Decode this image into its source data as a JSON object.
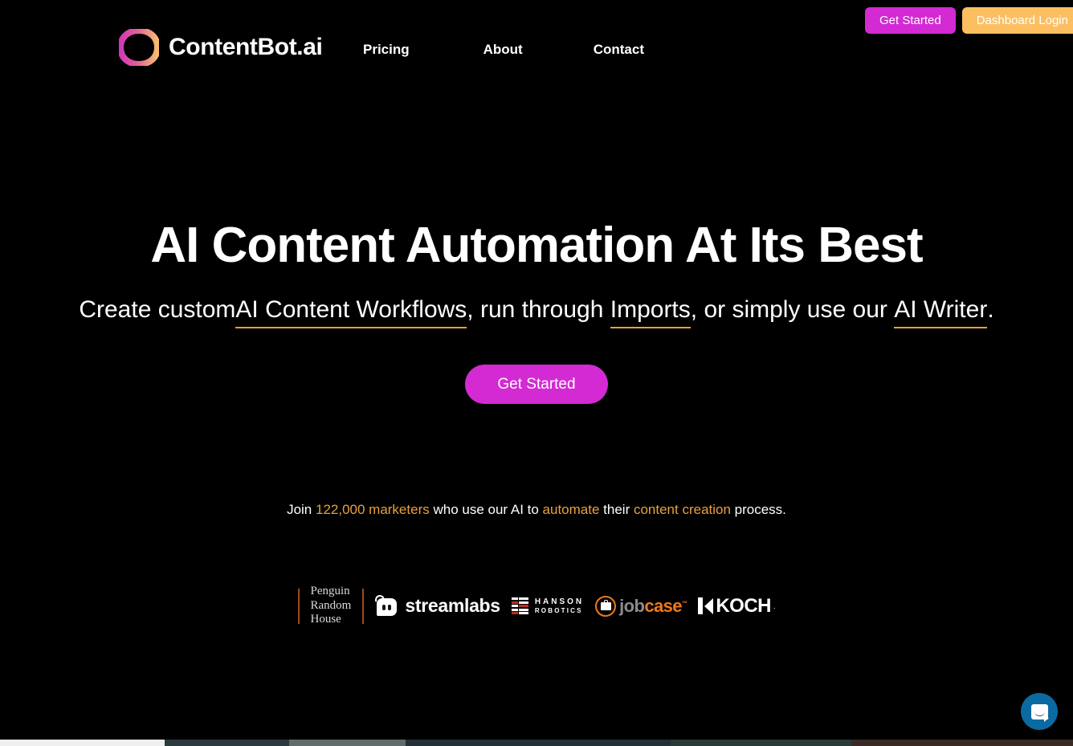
{
  "brand": {
    "name": "ContentBot.ai",
    "logo_icon": "gradient-ring-logo"
  },
  "nav": {
    "items": [
      {
        "label": "Pricing"
      },
      {
        "label": "About"
      },
      {
        "label": "Contact"
      }
    ]
  },
  "header_actions": {
    "get_started_label": "Get Started",
    "dashboard_login_label": "Dashboard Login"
  },
  "hero": {
    "title": "AI Content Automation At Its Best",
    "sub": {
      "part1": "Create custom",
      "link1": "AI Content Workflows",
      "part2": ", run through ",
      "link2": "Imports",
      "part3": ", or simply use our ",
      "link3": "AI Writer",
      "part4": "."
    },
    "cta_label": "Get Started"
  },
  "social_proof": {
    "p1": "Join ",
    "h1": "122,000 marketers",
    "p2": " who use our AI to ",
    "h2": "automate",
    "p3": " their ",
    "h3": "content creation",
    "p4": " process."
  },
  "logos": {
    "penguin_random_house": {
      "line1": "Penguin",
      "line2": "Random",
      "line3": "House"
    },
    "streamlabs": {
      "text": "streamlabs"
    },
    "hanson_robotics": {
      "line1": "HANSON",
      "line2": "ROBOTICS"
    },
    "jobcase": {
      "part1": "job",
      "part2": "case",
      "tm": "™"
    },
    "koch": {
      "text": "KOCH",
      "mark": "."
    }
  },
  "chat_widget": {
    "icon": "intercom-chat-bubble-icon"
  },
  "colors": {
    "background": "#000000",
    "magenta": "#D32AD3",
    "amber": "#FBBF62",
    "orange_accent": "#E8A13C",
    "intercom_blue": "#0B6AA2",
    "text": "#FFFFFF"
  }
}
